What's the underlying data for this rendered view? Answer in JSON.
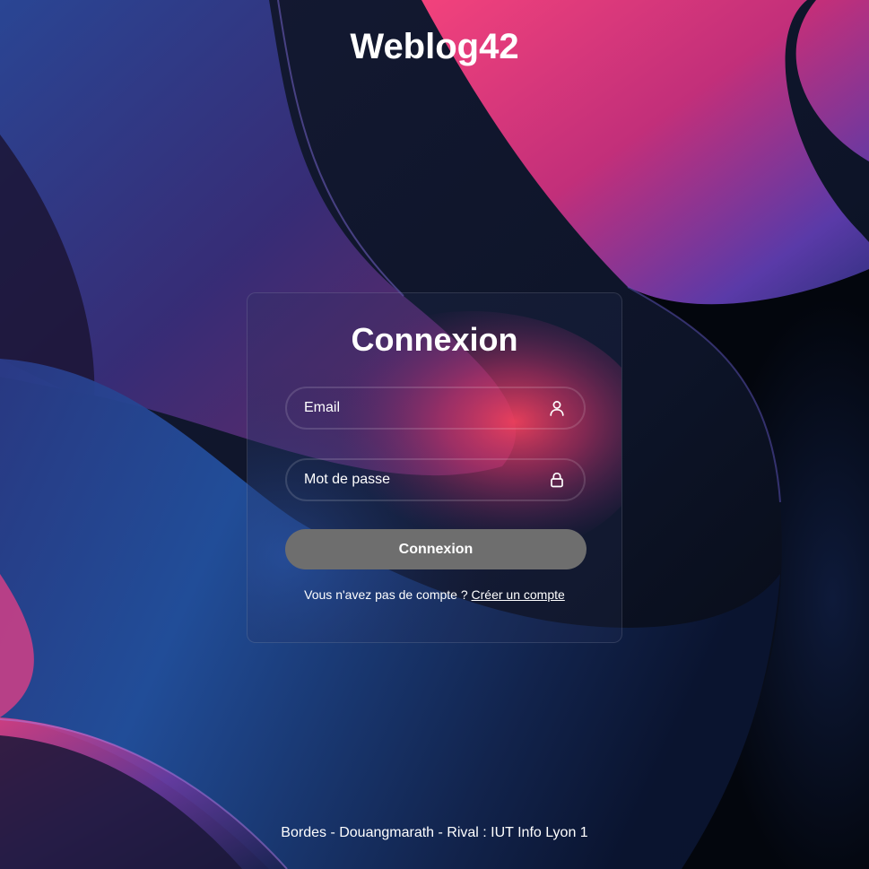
{
  "header": {
    "site_title": "Weblog42"
  },
  "login": {
    "title": "Connexion",
    "email_placeholder": "Email",
    "email_value": "",
    "password_placeholder": "Mot de passe",
    "password_value": "",
    "submit_label": "Connexion",
    "register_prompt": "Vous n'avez pas de compte ?",
    "register_link": "Créer un compte"
  },
  "footer": {
    "credits": "Bordes - Douangmarath - Rival : IUT Info Lyon 1"
  },
  "icons": {
    "email": "user-icon",
    "password": "lock-icon"
  },
  "colors": {
    "button": "#6e6e6e",
    "text": "#ffffff",
    "accent_pink": "#f0407a",
    "accent_blue": "#2a4fa0"
  }
}
